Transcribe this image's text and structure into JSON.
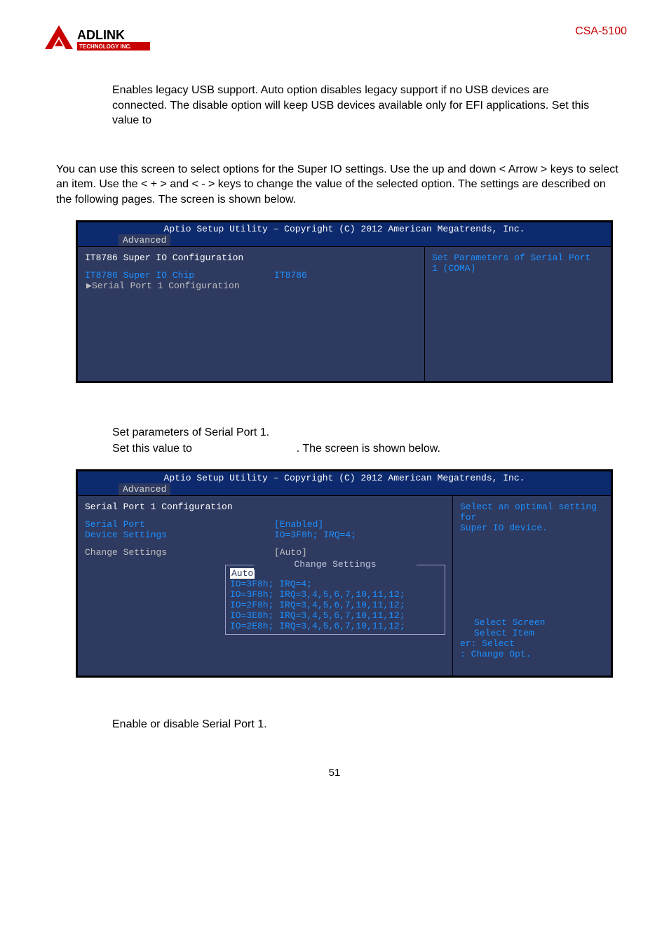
{
  "header": {
    "logo_top": "ADLINK",
    "logo_bottom": "TECHNOLOGY INC.",
    "model": "CSA-5100"
  },
  "section1": {
    "text": "Enables legacy USB support. Auto option disables legacy support if no USB devices are connected. The disable option will keep USB devices available only for EFI applications. Set this value to"
  },
  "section2": {
    "text": "You can use this screen to select options for the Super IO settings. Use the up and down < Arrow > keys to select an item. Use the < + > and < - > keys to change the value of the selected option. The settings are described on the following pages. The screen is shown below."
  },
  "bios1": {
    "title": "Aptio Setup Utility – Copyright (C) 2012 American Megatrends, Inc.",
    "tab": "Advanced",
    "left": {
      "heading": "IT8786 Super IO Configuration",
      "chip_label": "IT8786 Super IO Chip",
      "chip_value": "IT8786",
      "item1": "Serial Port 1 Configuration"
    },
    "right": {
      "help1": "Set Parameters of Serial Port",
      "help2": "1 (COMA)"
    }
  },
  "section3": {
    "line1": "Set parameters of Serial Port 1.",
    "line2a": "Set this value to",
    "line2b": ". The screen is shown below."
  },
  "bios2": {
    "title": "Aptio Setup Utility – Copyright (C) 2012 American Megatrends, Inc.",
    "tab": "Advanced",
    "left": {
      "heading": "Serial Port 1 Configuration",
      "sp_label": "Serial Port",
      "sp_value": "[Enabled]",
      "ds_label": "Device Settings",
      "ds_value": "IO=3F8h; IRQ=4;",
      "cs_label": "Change Settings",
      "cs_value": "[Auto]"
    },
    "right": {
      "help1": "Select an optimal setting for",
      "help2": "Super IO device."
    },
    "popup": {
      "title": "Change Settings",
      "opt0": "Auto",
      "opt1": "IO=3F8h; IRQ=4;",
      "opt2": "IO=3F8h; IRQ=3,4,5,6,7,10,11,12;",
      "opt3": "IO=2F8h; IRQ=3,4,5,6,7,10,11,12;",
      "opt4": "IO=3E8h; IRQ=3,4,5,6,7,10,11,12;",
      "opt5": "IO=2E8h; IRQ=3,4,5,6,7,10,11,12;"
    },
    "keys": {
      "k1": "Select Screen",
      "k2": "Select Item",
      "k3": "er: Select",
      "k4": ": Change Opt."
    }
  },
  "section4": {
    "text": "Enable or disable Serial Port 1."
  },
  "footer": {
    "page": "51"
  }
}
